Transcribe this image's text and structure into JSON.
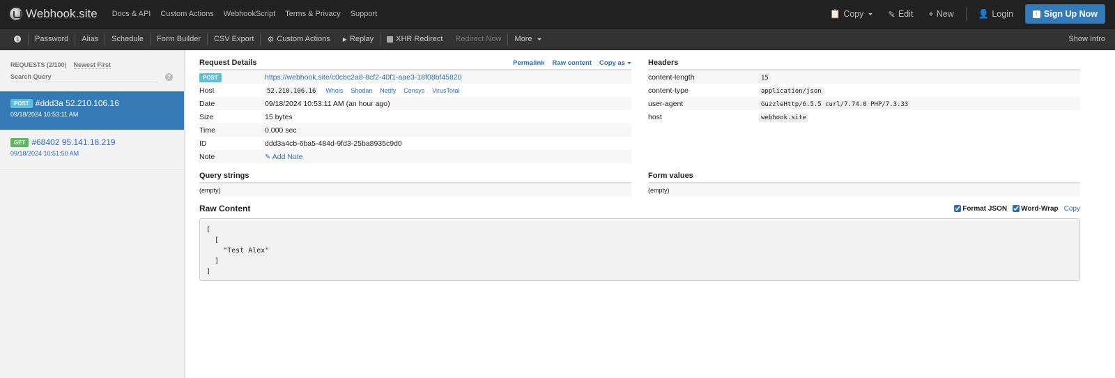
{
  "navbar": {
    "brand": "Webhook.site",
    "links": [
      "Docs & API",
      "Custom Actions",
      "WebhookScript",
      "Terms & Privacy",
      "Support"
    ],
    "copy": "Copy",
    "edit": "Edit",
    "new": "New",
    "login": "Login",
    "signup": "Sign Up Now"
  },
  "toolbar": {
    "items": [
      "Password",
      "Alias",
      "Schedule",
      "Form Builder",
      "CSV Export"
    ],
    "custom_actions": "Custom Actions",
    "replay": "Replay",
    "xhr_redirect": "XHR Redirect",
    "redirect_now": "Redirect Now",
    "more": "More",
    "show_intro": "Show Intro"
  },
  "sidebar": {
    "requests_label": "REQUESTS (2/100)",
    "sort": "Newest First",
    "search_placeholder": "Search Query",
    "help": "?",
    "requests": [
      {
        "method": "POST",
        "title": "#ddd3a 52.210.106.16",
        "time": "09/18/2024 10:53:11 AM"
      },
      {
        "method": "GET",
        "title": "#68402 95.141.18.219",
        "time": "09/18/2024 10:51:50 AM"
      }
    ]
  },
  "details": {
    "title": "Request Details",
    "permalink": "Permalink",
    "raw_content": "Raw content",
    "copy_as": "Copy as",
    "method": "POST",
    "url": "https://webhook.site/c0cbc2a8-8cf2-40f1-aae3-18f08bf45820",
    "host_label": "Host",
    "host": "52.210.106.16",
    "host_tools": [
      "Whois",
      "Shodan",
      "Netify",
      "Censys",
      "VirusTotal"
    ],
    "date_label": "Date",
    "date": "09/18/2024 10:53:11 AM (an hour ago)",
    "size_label": "Size",
    "size": "15 bytes",
    "time_label": "Time",
    "time": "0.000 sec",
    "id_label": "ID",
    "id": "ddd3a4cb-6ba5-484d-9fd3-25ba8935c9d0",
    "note_label": "Note",
    "add_note": "Add Note"
  },
  "headers": {
    "title": "Headers",
    "rows": [
      {
        "key": "content-length",
        "value": "15"
      },
      {
        "key": "content-type",
        "value": "application/json"
      },
      {
        "key": "user-agent",
        "value": "GuzzleHttp/6.5.5 curl/7.74.0 PHP/7.3.33"
      },
      {
        "key": "host",
        "value": "webhook.site"
      }
    ]
  },
  "query_strings": {
    "title": "Query strings",
    "value": "(empty)"
  },
  "form_values": {
    "title": "Form values",
    "value": "(empty)"
  },
  "raw": {
    "title": "Raw Content",
    "format_json": "Format JSON",
    "format_json_checked": true,
    "word_wrap": "Word-Wrap",
    "word_wrap_checked": true,
    "copy": "Copy",
    "body": "[\n  [\n    \"Test Alex\"\n  ]\n]"
  }
}
